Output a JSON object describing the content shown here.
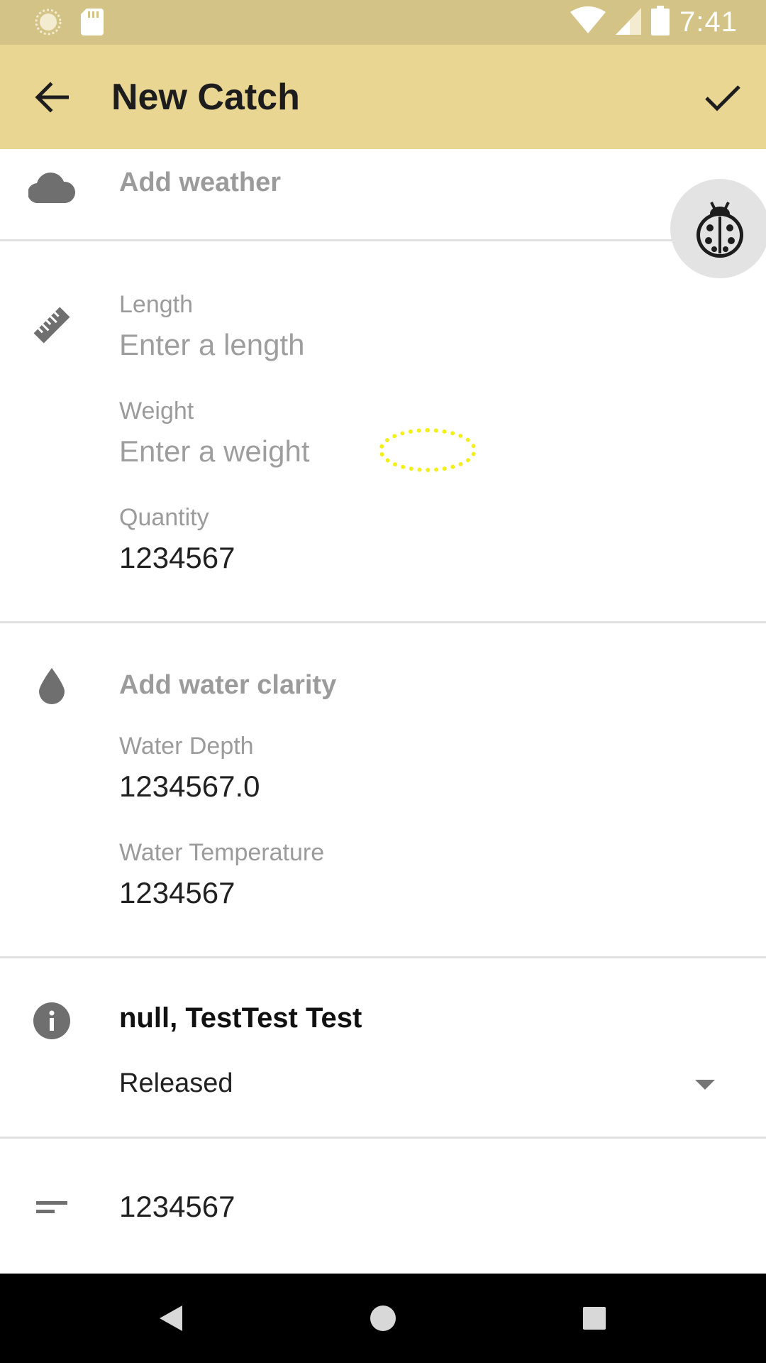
{
  "status_bar": {
    "time": "7:41",
    "icons": [
      "sync-icon",
      "sd-card-icon",
      "wifi-icon",
      "signal-icon",
      "battery-icon"
    ],
    "background": "#d4c386"
  },
  "app_bar": {
    "title": "New Catch",
    "back_icon": "arrow-back-icon",
    "save_icon": "check-icon",
    "background": "#e9d693"
  },
  "weather": {
    "icon": "cloud-icon",
    "label": "Add weather"
  },
  "measurements": {
    "icon": "ruler-icon",
    "length": {
      "label": "Length",
      "placeholder": "Enter a length",
      "value": ""
    },
    "weight": {
      "label": "Weight",
      "placeholder": "Enter a weight",
      "value": ""
    },
    "quantity": {
      "label": "Quantity",
      "value": "1234567"
    }
  },
  "water": {
    "icon": "water-drop-icon",
    "clarity_label": "Add water clarity",
    "depth": {
      "label": "Water Depth",
      "value": "1234567.0"
    },
    "temperature": {
      "label": "Water Temperature",
      "value": "1234567"
    }
  },
  "details": {
    "icon": "info-icon",
    "species": "null, TestTest Test",
    "catch_type": {
      "selected": "Released"
    }
  },
  "notes": {
    "icon": "notes-icon",
    "value": "1234567"
  },
  "debug_button": {
    "icon": "ladybug-icon"
  },
  "nav_bar": {
    "back": "nav-back-icon",
    "home": "nav-home-icon",
    "recents": "nav-recents-icon"
  },
  "colors": {
    "accent_bar": "#e9d693",
    "status_bar": "#d4c386",
    "muted_text": "#9b9b9b"
  }
}
